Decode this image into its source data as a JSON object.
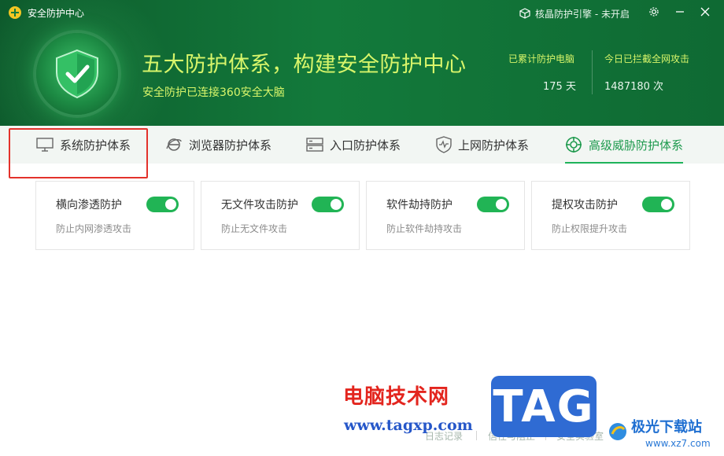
{
  "window": {
    "title": "安全防护中心",
    "engine_status": "核晶防护引擎 - 未开启",
    "icons": [
      "app-logo-icon",
      "gear-icon",
      "minimize-icon",
      "close-icon"
    ]
  },
  "hero": {
    "title": "五大防护体系，构建安全防护中心",
    "subtitle": "安全防护已连接360安全大脑"
  },
  "stats": [
    {
      "label": "已累计防护电脑",
      "value": "175 天"
    },
    {
      "label": "今日已拦截全网攻击",
      "value": "1487180 次"
    }
  ],
  "tabs": [
    {
      "label": "系统防护体系",
      "icon": "monitor-icon",
      "active": false
    },
    {
      "label": "浏览器防护体系",
      "icon": "browser-icon",
      "active": false
    },
    {
      "label": "入口防护体系",
      "icon": "server-icon",
      "active": false
    },
    {
      "label": "上网防护体系",
      "icon": "shield-pulse-icon",
      "active": false
    },
    {
      "label": "高级威胁防护体系",
      "icon": "target-icon",
      "active": true
    }
  ],
  "cards": [
    {
      "title": "横向渗透防护",
      "desc": "防止内网渗透攻击",
      "enabled": true
    },
    {
      "title": "无文件攻击防护",
      "desc": "防止无文件攻击",
      "enabled": true
    },
    {
      "title": "软件劫持防护",
      "desc": "防止软件劫持攻击",
      "enabled": true
    },
    {
      "title": "提权攻击防护",
      "desc": "防止权限提升攻击",
      "enabled": true
    }
  ],
  "footer": {
    "links": [
      "日志记录",
      "信任与阻止",
      "安全实验室"
    ]
  },
  "watermarks": {
    "site_cn": "电脑技术网",
    "site_url": "www.tagxp.com",
    "tag": "TAG",
    "brand": "极光下载站",
    "brand_url": "www.xz7.com"
  },
  "colors": {
    "header_green": "#137a3b",
    "accent_yellow": "#d8f56a",
    "toggle_green": "#21b455",
    "highlight_red": "#e3322b"
  }
}
